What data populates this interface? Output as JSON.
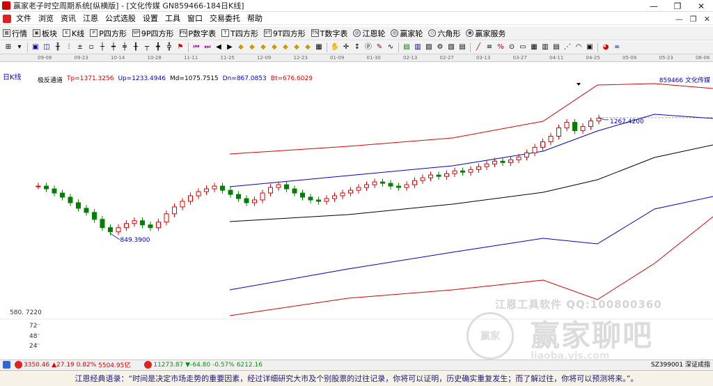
{
  "window": {
    "title": "赢家老子时空周期系统[纵横版] - [文化传媒  GN859466-184日K线]",
    "buttons": [
      "—",
      "❐",
      "✕"
    ]
  },
  "menu": {
    "items": [
      "文件",
      "浏览",
      "资讯",
      "江恩",
      "公式选股",
      "设置",
      "工具",
      "窗口",
      "交易委托",
      "帮助"
    ],
    "mdi_buttons": [
      "—",
      "❐",
      "✕"
    ]
  },
  "toolbar1": {
    "items": [
      {
        "label": "行情",
        "icon": "grid-icon"
      },
      {
        "label": "板块",
        "icon": "blocks-icon"
      },
      {
        "label": "K线",
        "icon": "candle-icon"
      },
      {
        "label": "P四方形",
        "icon": "p-square-icon"
      },
      {
        "label": "9P四方形",
        "icon": "9p-square-icon"
      },
      {
        "label": "P数字表",
        "icon": "p-table-icon"
      },
      {
        "label": "T四方形",
        "icon": "t-square-icon"
      },
      {
        "label": "9T四方形",
        "icon": "9t-square-icon"
      },
      {
        "label": "T数字表",
        "icon": "t-table-icon"
      },
      {
        "label": "江恩轮",
        "icon": "gann-wheel-icon"
      },
      {
        "label": "赢家轮",
        "icon": "winner-wheel-icon"
      },
      {
        "label": "六角形",
        "icon": "hexagon-icon"
      },
      {
        "label": "赢家服务",
        "icon": "service-icon"
      }
    ],
    "icon_glyphs": [
      "▦",
      "▣",
      "K",
      "P",
      "9P",
      "PN",
      "T",
      "9T",
      "TN",
      "◎",
      "◎",
      "◇",
      "◉"
    ]
  },
  "chart": {
    "period": "日K线",
    "indicator": "极反通道",
    "tp": "Tp=1371.3256",
    "up": "Up=1233.4946",
    "md": "Md=1075.7515",
    "dn": "Dn=867.0853",
    "bt": "Bt=676.6029",
    "stock": "859466  文化传媒",
    "low_label": "849.3900",
    "high_label": "1267.4200",
    "axis_value": "580. 7220",
    "volume_ticks": [
      "72",
      "48",
      "24"
    ],
    "dates": [
      "09-08",
      "09-23",
      "10-14",
      "10-28",
      "11-11",
      "11-25",
      "12-09",
      "12-23",
      "01-09",
      "01-30",
      "02-13",
      "02-27",
      "03-13",
      "03-27",
      "04-11",
      "04-25",
      "05-09",
      "05-23",
      "06-06"
    ]
  },
  "chart_data": {
    "type": "candlestick",
    "title": "",
    "series": [
      {
        "name": "Tp",
        "value": 1371.3256
      },
      {
        "name": "Up",
        "value": 1233.4946
      },
      {
        "name": "Md",
        "value": 1075.7515
      },
      {
        "name": "Dn",
        "value": 867.0853
      },
      {
        "name": "Bt",
        "value": 676.6029
      }
    ],
    "annotations": [
      {
        "text": "849.3900"
      },
      {
        "text": "1267.4200"
      }
    ],
    "close": [
      1020,
      1010,
      995,
      980,
      960,
      940,
      925,
      900,
      870,
      855,
      870,
      885,
      895,
      880,
      870,
      890,
      920,
      945,
      965,
      985,
      1000,
      1010,
      1020,
      1005,
      990,
      975,
      960,
      970,
      995,
      1015,
      1025,
      1010,
      995,
      980,
      970,
      965,
      975,
      985,
      995,
      1005,
      1015,
      1025,
      1035,
      1030,
      1020,
      1015,
      1025,
      1040,
      1050,
      1060,
      1055,
      1065,
      1075,
      1070,
      1080,
      1090,
      1100,
      1110,
      1105,
      1115,
      1125,
      1140,
      1160,
      1180,
      1200,
      1230,
      1250,
      1220,
      1235,
      1255,
      1265
    ],
    "colors": {
      "up": "#dd0000",
      "down": "#008000",
      "upper_band": "#dd0000",
      "mid_band": "#0000cc",
      "middle": "#000000"
    }
  },
  "watermark": {
    "line1": "江恩工具软件  QQ:100800360",
    "logo": "赢家",
    "line2": "赢家聊吧",
    "line3": "liaoba.yjs.com"
  },
  "statusbar": {
    "sh_value": "3350.46",
    "sh_change": "▲27.19",
    "sh_pct": "0.82%",
    "sh_amount": "5504.95亿",
    "sz_value": "11273.87",
    "sz_change": "▼-64.80",
    "sz_pct": "-0.57%",
    "sz_amount": "6212.16",
    "right_text": "SZ399001 深证成指"
  },
  "quote": {
    "text": "江恩经典语录：“时间是决定市场走势的重要因素，经过详细研究大市及个别股票的过往记录，你将可以证明，历史确实重复发生；而了解过往，你将可以预测将来。”。"
  }
}
